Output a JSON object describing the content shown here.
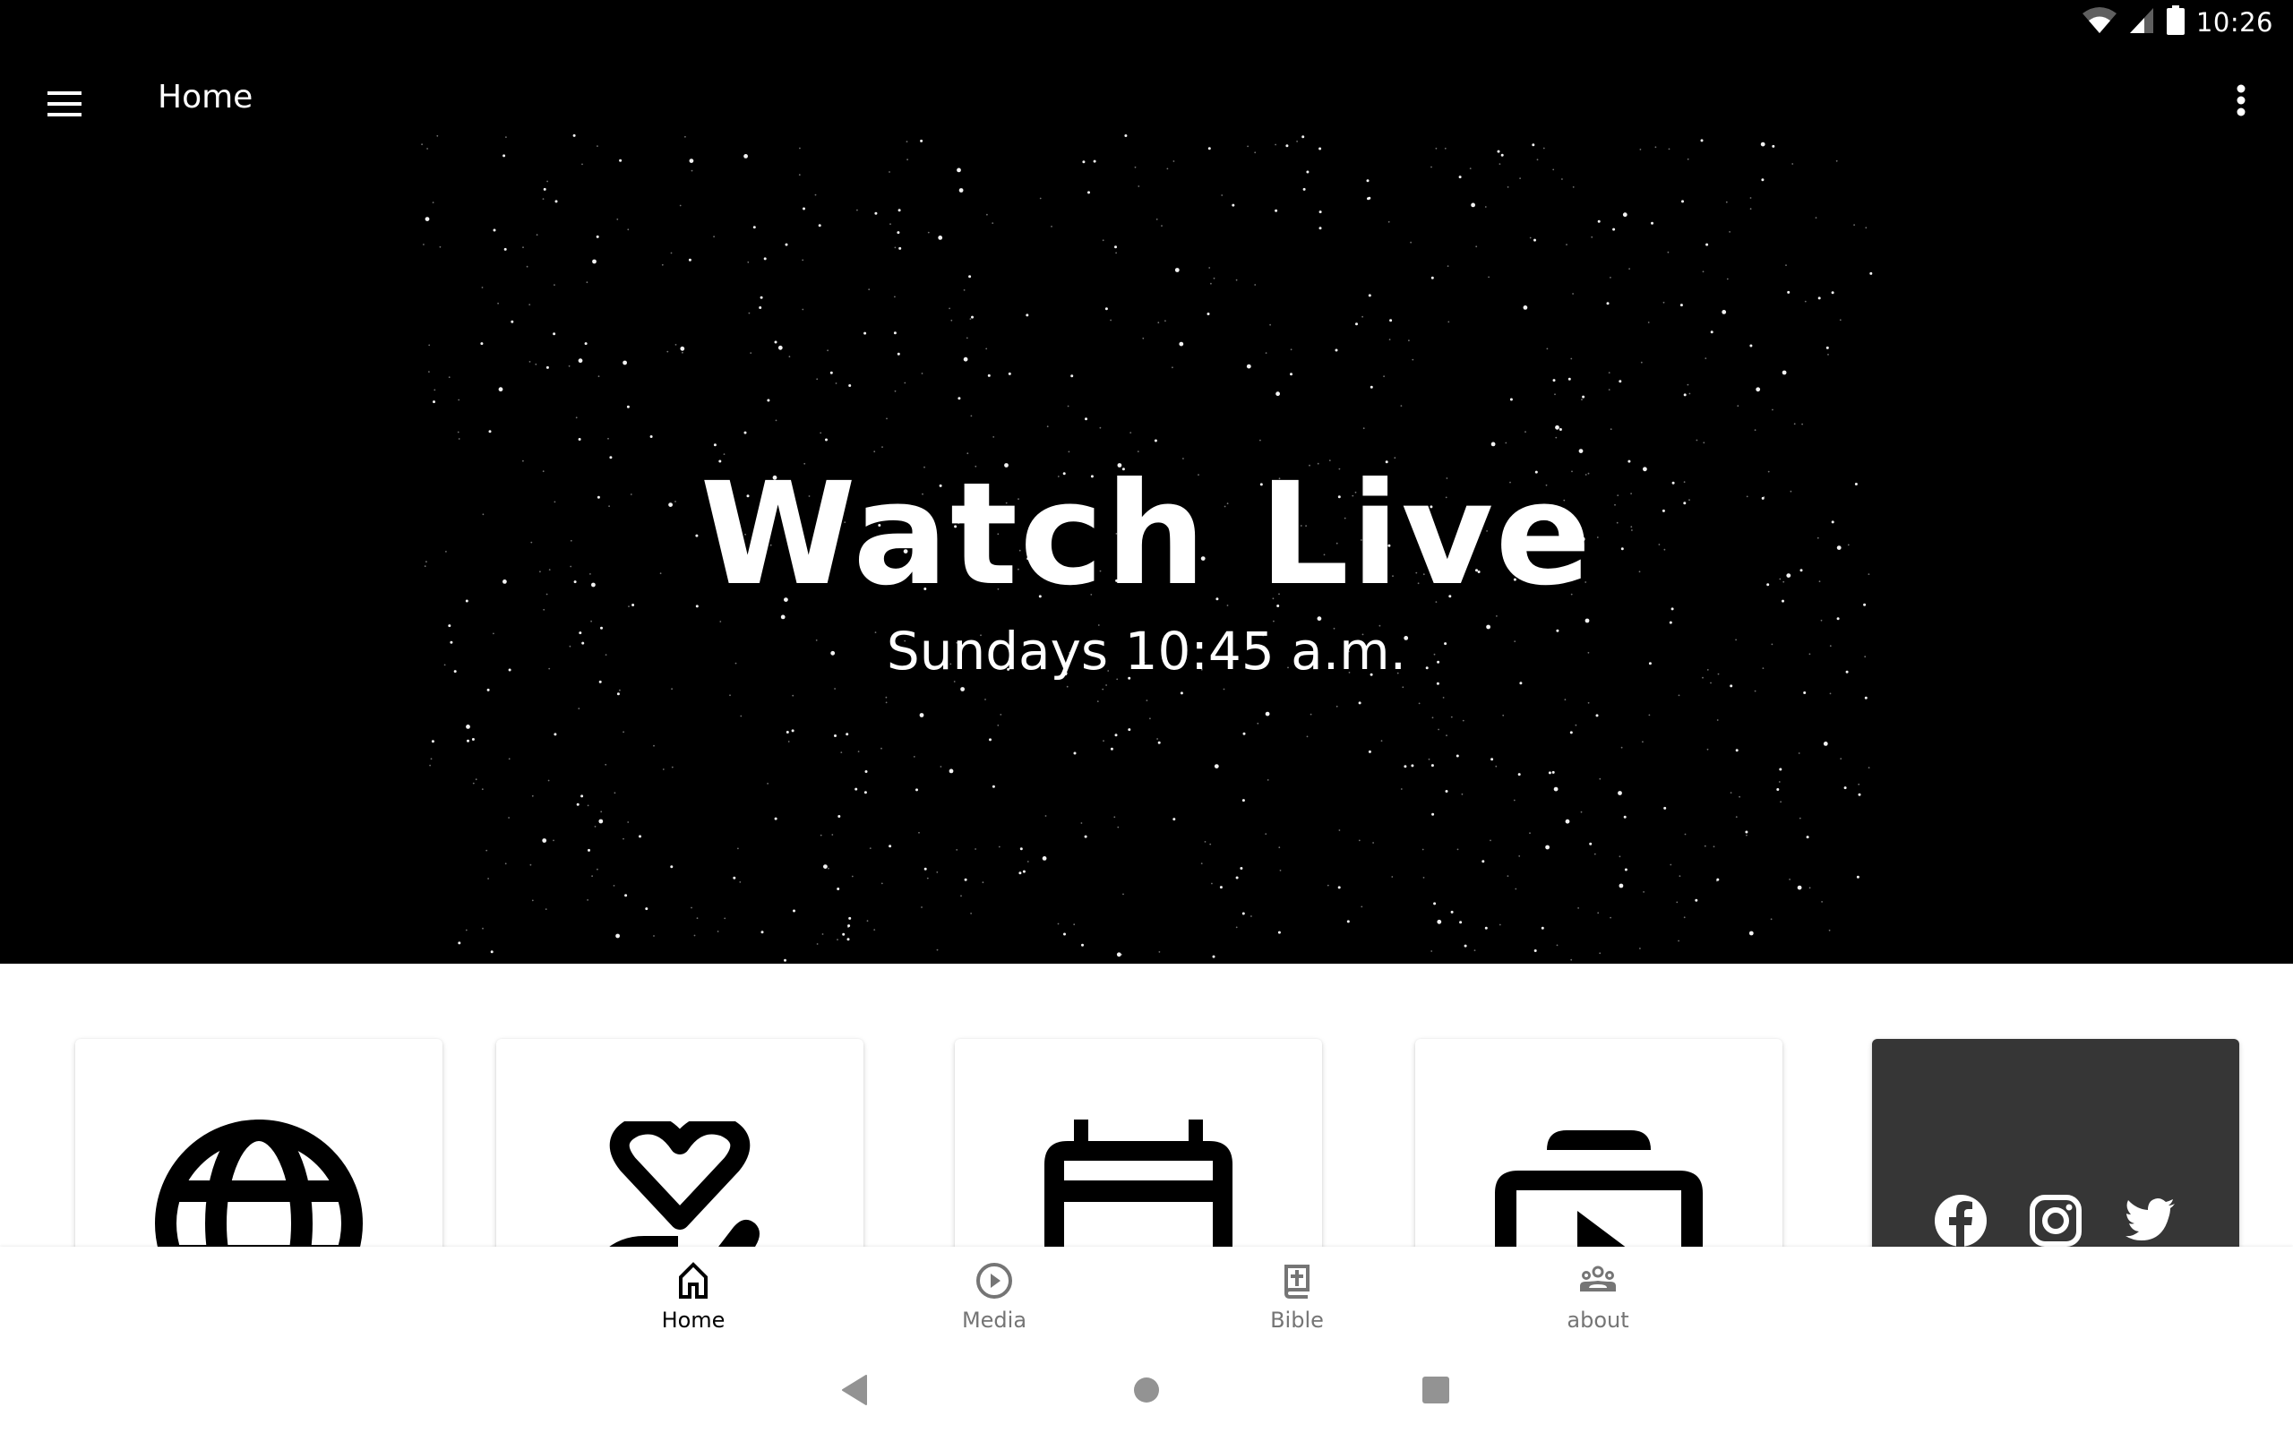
{
  "status_bar": {
    "time": "10:26",
    "icons": [
      "wifi-icon",
      "cell-signal-icon",
      "battery-icon"
    ]
  },
  "app_bar": {
    "title": "Home",
    "menu_icon": "hamburger-menu-icon",
    "overflow_icon": "more-vert-icon"
  },
  "hero": {
    "title": "Watch Live",
    "subtitle": "Sundays 10:45 a.m."
  },
  "cards": [
    {
      "icon": "globe-icon"
    },
    {
      "icon": "volunteer-heart-hand-icon"
    },
    {
      "icon": "calendar-icon"
    },
    {
      "icon": "video-library-icon"
    },
    {
      "icon": "social-links",
      "social": [
        "facebook-icon",
        "instagram-icon",
        "twitter-icon"
      ]
    }
  ],
  "bottom_nav": {
    "active": "Home",
    "items": [
      {
        "label": "Home",
        "icon": "home-icon"
      },
      {
        "label": "Media",
        "icon": "play-circle-icon"
      },
      {
        "label": "Bible",
        "icon": "bible-icon"
      },
      {
        "label": "about",
        "icon": "groups-icon"
      }
    ]
  },
  "system_nav": {
    "buttons": [
      "back",
      "home",
      "recents"
    ]
  },
  "colors": {
    "hero_bg": "#000000",
    "dark_card": "#363636",
    "nav_inactive": "#757575",
    "nav_active": "#000000",
    "system_nav": "#939393"
  }
}
